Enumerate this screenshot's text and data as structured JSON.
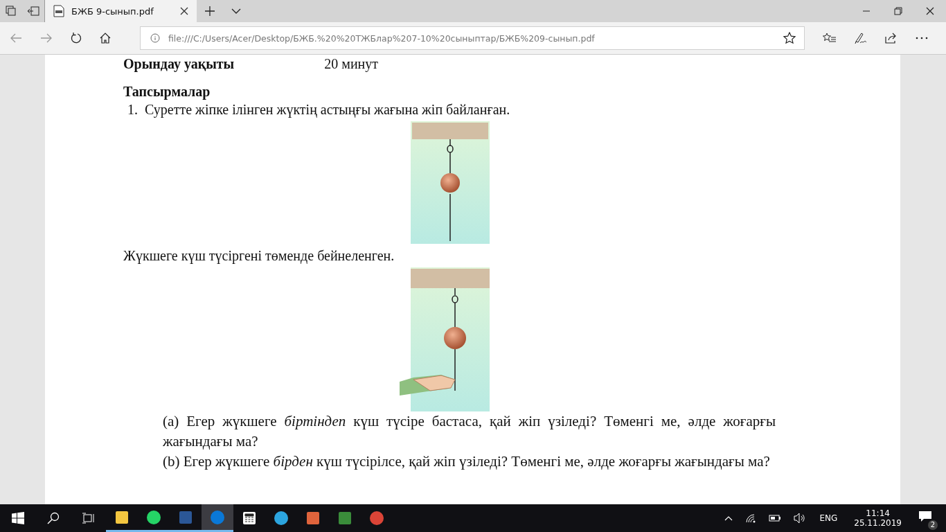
{
  "tabs": [
    {
      "title": "БЖБ 9-сынып.pdf",
      "selected": true
    }
  ],
  "address": {
    "url": "file:///C:/Users/Acer/Desktop/БЖБ.%20%20ТЖБлар%207-10%20сыныптар/БЖБ%209-сынып.pdf"
  },
  "document": {
    "info_row": {
      "label": "Орындау уақыты",
      "value": "20 минут"
    },
    "heading": "Тапсырмалар",
    "question": {
      "number": "1.",
      "text": "Суретте жіпке ілінген жүктің астыңғы жағына жіп байланған."
    },
    "caption": "Жүкшеге күш түсіргені төменде бейнеленген.",
    "parts": [
      {
        "text": "(a) Егер жүкшеге *біртіндеп* күш түсіре бастаса, қай жіп үзіледі? Төменгі ме, әлде жоғарғы жағындағы ма?"
      },
      {
        "text": "(b) Егер жүкшеге *бірден* күш түсірілсе, қай жіп үзіледі? Төменгі ме, әлде жоғарғы жағындағы ма?"
      }
    ]
  },
  "taskbar": {
    "apps": [
      {
        "kind": "explorer",
        "running": true,
        "selected": false
      },
      {
        "kind": "whatsapp",
        "running": true,
        "selected": false
      },
      {
        "kind": "word",
        "running": true,
        "selected": false
      },
      {
        "kind": "edge",
        "running": true,
        "selected": true
      },
      {
        "kind": "calculator",
        "running": false,
        "selected": false
      },
      {
        "kind": "telegram",
        "running": false,
        "selected": false
      },
      {
        "kind": "powerpoint",
        "running": false,
        "selected": false
      },
      {
        "kind": "excel",
        "running": false,
        "selected": false
      },
      {
        "kind": "chrome",
        "running": false,
        "selected": false
      }
    ],
    "language": "ENG",
    "time": "11:14",
    "date": "25.11.2019",
    "notifications": "2"
  }
}
